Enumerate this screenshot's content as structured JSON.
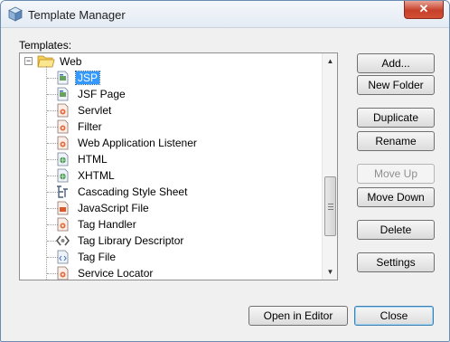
{
  "window": {
    "title": "Template Manager",
    "close_glyph": "✕"
  },
  "templates_label": "Templates:",
  "tree": {
    "root": {
      "label": "Web",
      "expander": "−"
    },
    "items": [
      {
        "label": "JSP",
        "icon": "jsp-file-icon",
        "selected": true
      },
      {
        "label": "JSF Page",
        "icon": "jsp-file-icon",
        "selected": false
      },
      {
        "label": "Servlet",
        "icon": "java-class-icon",
        "selected": false
      },
      {
        "label": "Filter",
        "icon": "java-class-icon",
        "selected": false
      },
      {
        "label": "Web Application Listener",
        "icon": "java-class-icon",
        "selected": false
      },
      {
        "label": "HTML",
        "icon": "html-file-icon",
        "selected": false
      },
      {
        "label": "XHTML",
        "icon": "html-file-icon",
        "selected": false
      },
      {
        "label": "Cascading Style Sheet",
        "icon": "css-file-icon",
        "selected": false
      },
      {
        "label": "JavaScript File",
        "icon": "js-file-icon",
        "selected": false
      },
      {
        "label": "Tag Handler",
        "icon": "java-class-icon",
        "selected": false
      },
      {
        "label": "Tag Library Descriptor",
        "icon": "tld-file-icon",
        "selected": false
      },
      {
        "label": "Tag File",
        "icon": "tag-file-icon",
        "selected": false
      },
      {
        "label": "Service Locator",
        "icon": "java-class-icon",
        "selected": false
      }
    ]
  },
  "buttons": {
    "add": "Add...",
    "new_folder": "New Folder",
    "duplicate": "Duplicate",
    "rename": "Rename",
    "move_up": "Move Up",
    "move_down": "Move Down",
    "delete": "Delete",
    "settings": "Settings",
    "open_in_editor": "Open in Editor",
    "close": "Close"
  },
  "colors": {
    "selection": "#3399ff",
    "dialog_bg": "#f0f0f0",
    "close_button": "#c7402a"
  }
}
